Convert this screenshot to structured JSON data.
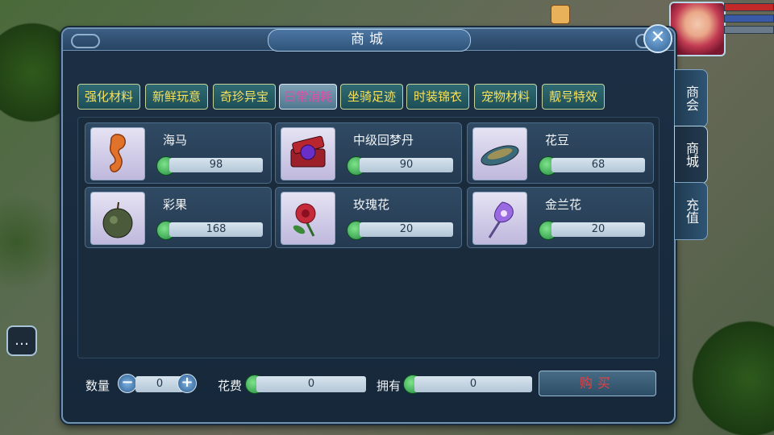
{
  "shop": {
    "title": "商城",
    "close_glyph": "✕",
    "tabs": [
      {
        "label": "强化材料",
        "active": false
      },
      {
        "label": "新鲜玩意",
        "active": false
      },
      {
        "label": "奇珍异宝",
        "active": false
      },
      {
        "label": "日常消耗",
        "active": true
      },
      {
        "label": "坐骑足迹",
        "active": false
      },
      {
        "label": "时装锦衣",
        "active": false
      },
      {
        "label": "宠物材料",
        "active": false
      },
      {
        "label": "靓号特效",
        "active": false
      }
    ],
    "items": [
      {
        "name": "海马",
        "price": "98",
        "icon": "seahorse-icon"
      },
      {
        "name": "中级回梦丹",
        "price": "90",
        "icon": "pill-box-icon"
      },
      {
        "name": "花豆",
        "price": "68",
        "icon": "bean-icon"
      },
      {
        "name": "彩果",
        "price": "168",
        "icon": "fruit-icon"
      },
      {
        "name": "玫瑰花",
        "price": "20",
        "icon": "rose-icon"
      },
      {
        "name": "金兰花",
        "price": "20",
        "icon": "orchid-icon"
      }
    ],
    "quantity_label": "数量",
    "quantity_value": "0",
    "minus_glyph": "−",
    "plus_glyph": "+",
    "cost_label": "花费",
    "cost_value": "0",
    "owned_label": "拥有",
    "owned_value": "0",
    "buy_label": "购买"
  },
  "side_tabs": [
    {
      "label": "商会",
      "active": false
    },
    {
      "label": "商城",
      "active": true
    },
    {
      "label": "充值",
      "active": false
    }
  ],
  "hud": {
    "chat_icon": "chat-bubble-icon",
    "chat_glyph": "…"
  },
  "colors": {
    "tab_text": "#f6e25a",
    "active_tab_text": "#e04caa",
    "buy_text": "#e63f43",
    "coin": "#2fb84e"
  }
}
